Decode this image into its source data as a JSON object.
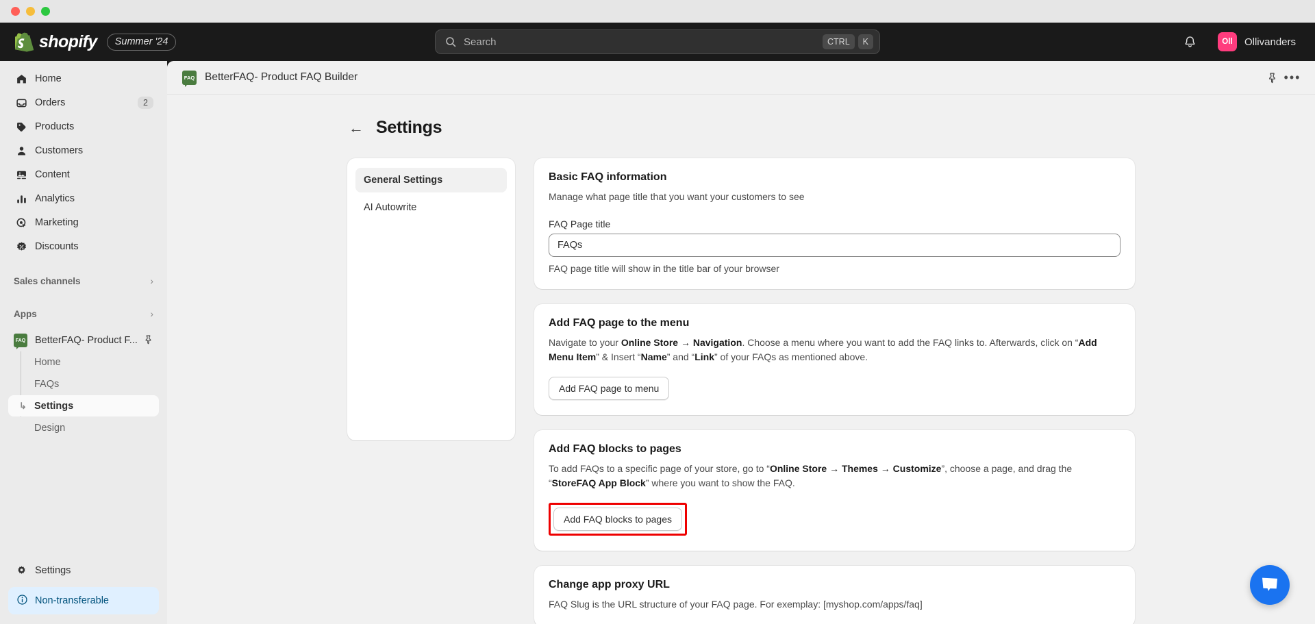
{
  "window": {
    "traffic_lights": [
      "close",
      "minimize",
      "maximize"
    ]
  },
  "topbar": {
    "brand_name": "shopify",
    "season_badge": "Summer '24",
    "search": {
      "placeholder": "Search",
      "shortcut_modifier": "CTRL",
      "shortcut_key": "K"
    },
    "notifications_icon": "bell-icon",
    "user": {
      "initials": "Oll",
      "name": "Ollivanders"
    }
  },
  "sidebar": {
    "nav_items": [
      {
        "label": "Home",
        "icon": "home-icon",
        "count": ""
      },
      {
        "label": "Orders",
        "icon": "orders-icon",
        "count": "2"
      },
      {
        "label": "Products",
        "icon": "products-tag-icon",
        "count": ""
      },
      {
        "label": "Customers",
        "icon": "customers-person-icon",
        "count": ""
      },
      {
        "label": "Content",
        "icon": "content-image-icon",
        "count": ""
      },
      {
        "label": "Analytics",
        "icon": "analytics-bars-icon",
        "count": ""
      },
      {
        "label": "Marketing",
        "icon": "marketing-target-icon",
        "count": ""
      },
      {
        "label": "Discounts",
        "icon": "discounts-badge-icon",
        "count": ""
      }
    ],
    "sections": [
      {
        "label": "Sales channels",
        "chevron": "›"
      },
      {
        "label": "Apps",
        "chevron": "›"
      }
    ],
    "app": {
      "label": "BetterFAQ- Product F...",
      "icon_text": "FAQ",
      "pin_icon": "pin-icon",
      "sub_items": [
        {
          "label": "Home",
          "active": false
        },
        {
          "label": "FAQs",
          "active": false
        },
        {
          "label": "Settings",
          "active": true
        },
        {
          "label": "Design",
          "active": false
        }
      ]
    },
    "settings_item": {
      "label": "Settings",
      "icon": "gear-icon"
    },
    "banner": {
      "label": "Non-transferable",
      "icon": "info-circle-icon"
    }
  },
  "app_header": {
    "icon_text": "FAQ",
    "title": "BetterFAQ- Product FAQ Builder",
    "pin_icon": "pin-icon",
    "more_icon": "more-horizontal-icon"
  },
  "page": {
    "back_arrow": "←",
    "title": "Settings"
  },
  "settings_menu": {
    "items": [
      {
        "label": "General Settings",
        "active": true
      },
      {
        "label": "AI Autowrite",
        "active": false
      }
    ]
  },
  "cards": {
    "basic_faq": {
      "title": "Basic FAQ information",
      "description": "Manage what page title that you want your customers to see",
      "field_label": "FAQ Page title",
      "field_value": "FAQs",
      "field_placeholder": "FAQs",
      "help_text": "FAQ page title will show in the title bar of your browser"
    },
    "add_to_menu": {
      "title": "Add FAQ page to the menu",
      "desc_part1": "Navigate to your ",
      "desc_bold1": "Online Store → Navigation",
      "desc_part2": ". Choose a menu where you want to add the FAQ links to. Afterwards, click on “",
      "desc_bold2": "Add Menu Item",
      "desc_part3": "” & Insert “",
      "desc_bold3": "Name",
      "desc_part4": "” and “",
      "desc_bold4": "Link",
      "desc_part5": "” of your FAQs as mentioned above.",
      "button_label": "Add FAQ page to menu"
    },
    "add_blocks": {
      "title": "Add FAQ blocks to pages",
      "desc_part1": "To add FAQs to a specific page of your store, go to “",
      "desc_bold1": "Online Store → Themes → Customize",
      "desc_part2": "”, choose a page, and drag the “",
      "desc_bold2": "StoreFAQ App Block",
      "desc_part3": "” where you want to show the FAQ.",
      "button_label": "Add FAQ blocks to pages",
      "highlighted": true,
      "highlight_color": "#ee0000"
    },
    "proxy_url": {
      "title": "Change app proxy URL",
      "description": "FAQ Slug is the URL structure of your FAQ page. For exemplay: [myshop.com/apps/faq]"
    }
  },
  "chat_launcher": {
    "icon": "chat-bubble-icon",
    "color": "#1a73f0"
  }
}
